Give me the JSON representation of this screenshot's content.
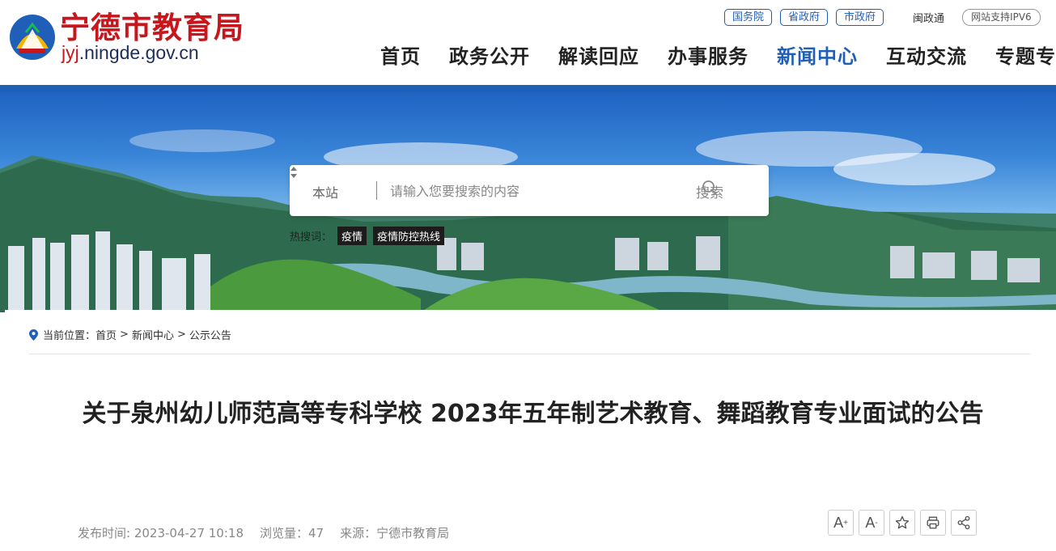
{
  "header": {
    "logo_cn": "宁德市教育局",
    "logo_domain_prefix": "jyj",
    "logo_domain_suffix": ".ningde.gov.cn",
    "top_links": [
      "国务院",
      "省政府",
      "市政府"
    ],
    "min_zheng_tong": "闽政通",
    "ipv6": "网站支持IPV6",
    "nav": [
      "首页",
      "政务公开",
      "解读回应",
      "办事服务",
      "新闻中心",
      "互动交流",
      "专题专栏"
    ],
    "active_nav": "新闻中心"
  },
  "search": {
    "scope": "本站",
    "placeholder": "请输入您要搜索的内容",
    "button": "搜索",
    "hot_label": "热搜词：",
    "hot_words": [
      "疫情",
      "疫情防控热线"
    ]
  },
  "breadcrumb": {
    "label": "当前位置：",
    "items": [
      "首页",
      "新闻中心",
      "公示公告"
    ],
    "separator": ">"
  },
  "article": {
    "title": "关于泉州幼儿师范高等专科学校 2023年五年制艺术教育、舞蹈教育专业面试的公告",
    "publish_time": "发布时间: 2023-04-27 10:18",
    "views": "浏览量：47",
    "source": "来源：宁德市教育局"
  },
  "tools": {
    "font_up": "A",
    "font_up_sup": "+",
    "font_down": "A",
    "font_down_sup": "-"
  },
  "colors": {
    "brand_red": "#c8161d",
    "brand_blue": "#1f5fb8"
  }
}
